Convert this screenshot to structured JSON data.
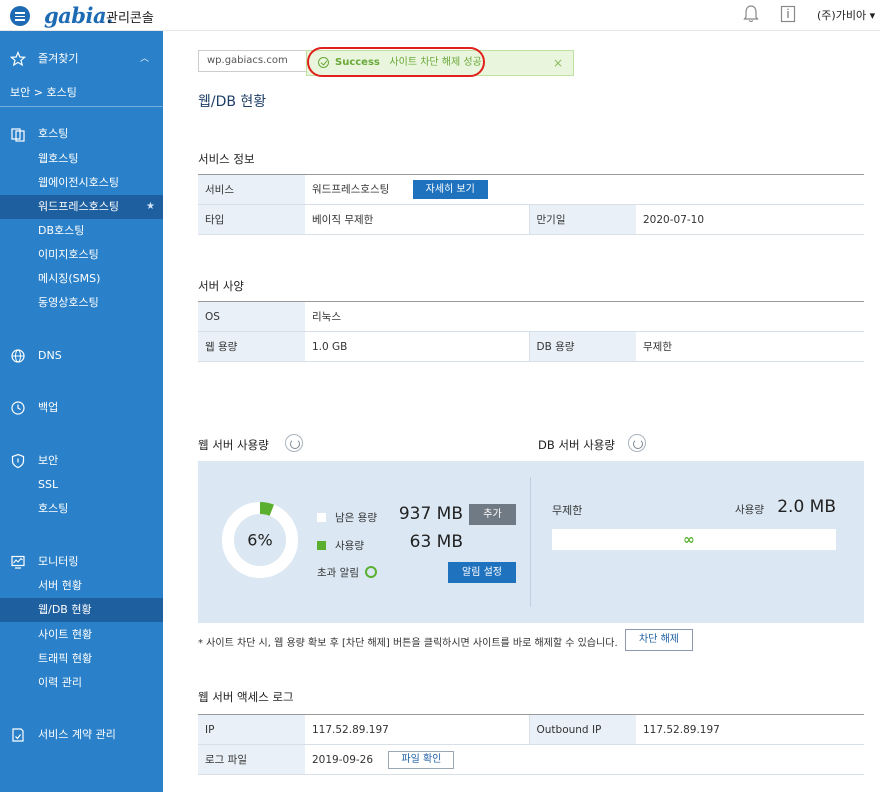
{
  "header": {
    "logo": "gabia.",
    "console_title": "관리콘솔",
    "user_menu": "(주)가비아"
  },
  "sidebar": {
    "favorites": "즐겨찾기",
    "breadcrumb": "보안 > 호스팅",
    "hosting": {
      "label": "호스팅",
      "items": [
        "웹호스팅",
        "웹에이전시호스팅",
        "워드프레스호스팅",
        "DB호스팅",
        "이미지호스팅",
        "메시징(SMS)",
        "동영상호스팅"
      ]
    },
    "dns": "DNS",
    "backup": "백업",
    "security": {
      "label": "보안",
      "items": [
        "SSL",
        "호스팅"
      ]
    },
    "monitoring": {
      "label": "모니터링",
      "items": [
        "서버 현황",
        "웹/DB 현황",
        "사이트 현황",
        "트래픽 현황",
        "이력 관리"
      ]
    },
    "contract": "서비스 계약 관리"
  },
  "main": {
    "url": "wp.gabiacs.com",
    "toast": {
      "status": "Success",
      "message": "사이트 차단 해제 성공",
      "close": "×"
    },
    "page_title": "웹/DB 현황",
    "service_info": {
      "title": "서비스 정보",
      "service_label": "서비스",
      "service_value": "워드프레스호스팅",
      "detail_button": "자세히 보기",
      "type_label": "타입",
      "type_value": "베이직 무제한",
      "expiry_label": "만기일",
      "expiry_value": "2020-07-10"
    },
    "server_spec": {
      "title": "서버 사양",
      "os_label": "OS",
      "os_value": "리눅스",
      "web_cap_label": "웹 용량",
      "web_cap_value": "1.0 GB",
      "db_cap_label": "DB 용량",
      "db_cap_value": "무제한"
    },
    "web_usage": {
      "title": "웹 서버 사용량",
      "percent_label": "6%",
      "percent_used": 6,
      "remaining_label": "남은 용량",
      "remaining_value": "937 MB",
      "add_button": "추가",
      "used_label": "사용량",
      "used_value": "63 MB",
      "alert_label": "초과 알림",
      "alert_button": "알림 설정"
    },
    "db_usage": {
      "title": "DB 서버 사용량",
      "limit_label": "무제한",
      "used_label": "사용량",
      "used_value": "2.0 MB",
      "infinity": "∞"
    },
    "notice": "* 사이트 차단 시, 웹 용량 확보 후 [차단 해제] 버튼을 클릭하시면 사이트를 바로 해제할 수 있습니다.",
    "unblock_button": "차단 해제",
    "access_log": {
      "title": "웹 서버 액세스 로그",
      "ip_label": "IP",
      "ip_value": "117.52.89.197",
      "outbound_label": "Outbound IP",
      "outbound_value": "117.52.89.197",
      "logfile_label": "로그 파일",
      "logfile_value": "2019-09-26",
      "file_button": "파일 확인"
    }
  },
  "colors": {
    "sidebar": "#2a81c9",
    "sidebar_active": "#1e5fa0",
    "primary": "#1f72be",
    "success": "#5ab02e",
    "panel": "#dbe8f4",
    "highlight": "#e0201a"
  }
}
